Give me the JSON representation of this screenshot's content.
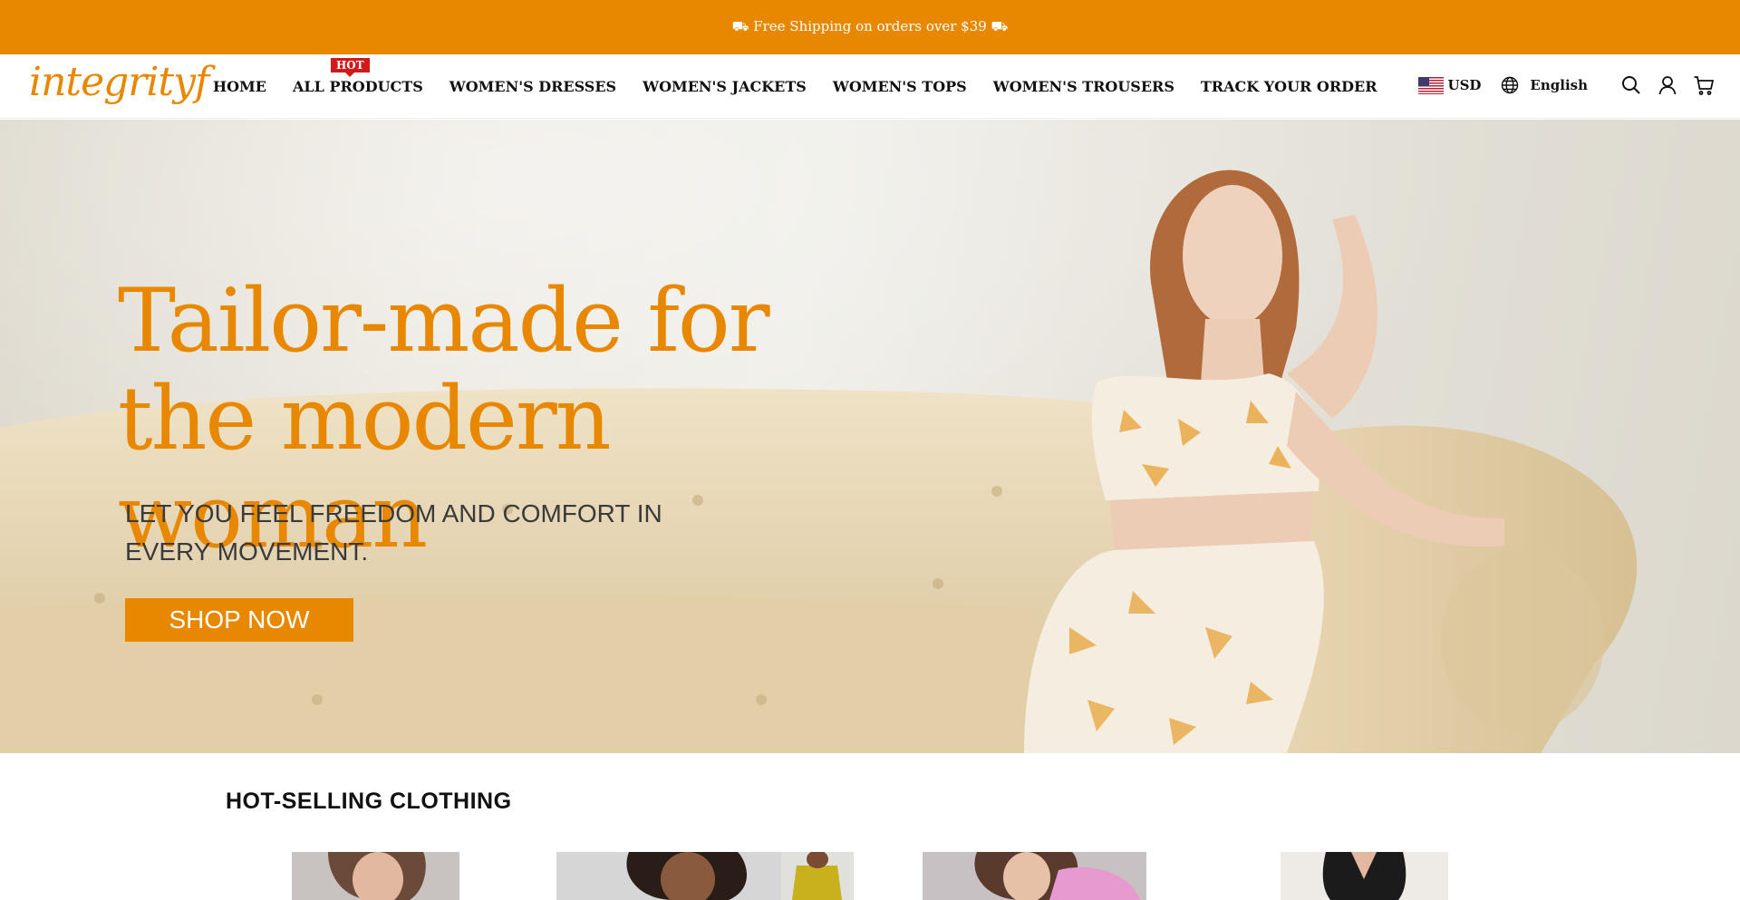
{
  "announcement": {
    "text": "⛟ Free Shipping on orders over $39 ⛟"
  },
  "header": {
    "logo": "integrityf",
    "nav": [
      {
        "label": "HOME"
      },
      {
        "label": "ALL PRODUCTS",
        "badge": "HOT"
      },
      {
        "label": "WOMEN'S DRESSES"
      },
      {
        "label": "WOMEN'S JACKETS"
      },
      {
        "label": "WOMEN'S TOPS"
      },
      {
        "label": "WOMEN'S TROUSERS"
      },
      {
        "label": "TRACK YOUR ORDER"
      }
    ],
    "currency": "USD",
    "language": "English",
    "icons": [
      "us-flag-icon",
      "globe-icon",
      "search-icon",
      "account-icon",
      "cart-icon"
    ]
  },
  "hero": {
    "title_line1": "Tailor-made for",
    "title_line2": "the modern woman",
    "subtitle_line1": "LET YOU FEEL FREEDOM AND COMFORT IN",
    "subtitle_line2": "EVERY MOVEMENT.",
    "cta": "SHOP NOW"
  },
  "section": {
    "title": "HOT-SELLING CLOTHING"
  },
  "colors": {
    "brand": "#e88700",
    "hot_badge": "#d11a1a",
    "text": "#111111"
  }
}
